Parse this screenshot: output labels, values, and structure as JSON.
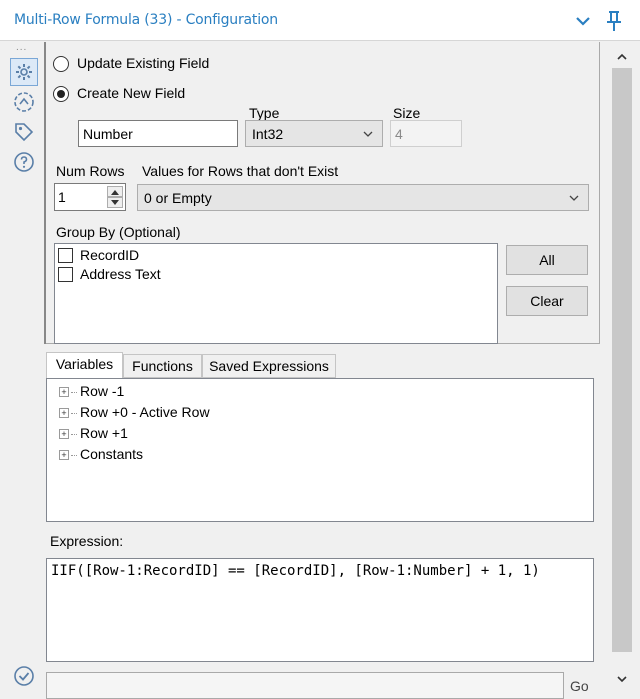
{
  "window": {
    "title": "Multi-Row Formula (33) - Configuration"
  },
  "rail": {
    "more": "..."
  },
  "config": {
    "update_label": "Update Existing Field",
    "create_label": "Create New  Field",
    "type_label": "Type",
    "size_label": "Size",
    "field_name": "Number",
    "type_value": "Int32",
    "size_value": "4",
    "num_rows_label": "Num Rows",
    "num_rows_value": "1",
    "nonexist_label": "Values for Rows that don't Exist",
    "nonexist_value": "0 or Empty",
    "group_by_label": "Group By (Optional)",
    "group_by_items": [
      "RecordID",
      "Address Text"
    ],
    "all_button": "All",
    "clear_button": "Clear"
  },
  "tabs": [
    "Variables",
    "Functions",
    "Saved Expressions"
  ],
  "tree": [
    "Row -1",
    "Row +0 - Active Row",
    "Row +1",
    "Constants"
  ],
  "expression": {
    "label": "Expression:",
    "value": "IIF([Row-1:RecordID] == [RecordID], [Row-1:Number] + 1, 1)"
  },
  "footer": {
    "go_label": "Go"
  }
}
